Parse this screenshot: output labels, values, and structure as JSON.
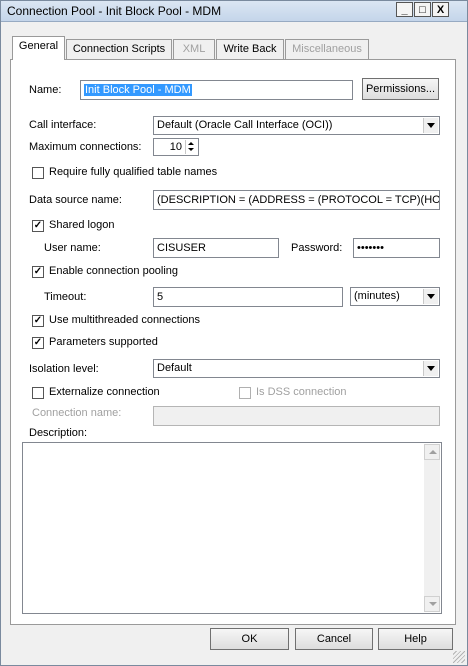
{
  "window": {
    "title": "Connection Pool - Init Block Pool - MDM",
    "minimize": "_",
    "maximize": "□",
    "close": "X"
  },
  "tabs": [
    {
      "label": "General",
      "active": true,
      "enabled": true
    },
    {
      "label": "Connection Scripts",
      "active": false,
      "enabled": true
    },
    {
      "label": "XML",
      "active": false,
      "enabled": false
    },
    {
      "label": "Write Back",
      "active": false,
      "enabled": true
    },
    {
      "label": "Miscellaneous",
      "active": false,
      "enabled": false
    }
  ],
  "general": {
    "name_label": "Name:",
    "name_value": "Init Block Pool - MDM",
    "permissions_button": "Permissions...",
    "call_interface_label": "Call interface:",
    "call_interface_value": "Default (Oracle Call Interface (OCI))",
    "max_connections_label": "Maximum connections:",
    "max_connections_value": "10",
    "require_qualified_label": "Require fully qualified table names",
    "require_qualified_checked": false,
    "data_source_label": "Data source name:",
    "data_source_value": "(DESCRIPTION = (ADDRESS = (PROTOCOL = TCP)(HO",
    "shared_logon_label": "Shared logon",
    "shared_logon_checked": true,
    "user_name_label": "User name:",
    "user_name_value": "CISUSER",
    "password_label": "Password:",
    "password_value": "•••••••",
    "enable_pooling_label": "Enable connection pooling",
    "enable_pooling_checked": true,
    "timeout_label": "Timeout:",
    "timeout_value": "5",
    "timeout_unit": "(minutes)",
    "multithreaded_label": "Use multithreaded connections",
    "multithreaded_checked": true,
    "parameters_label": "Parameters supported",
    "parameters_checked": true,
    "isolation_label": "Isolation level:",
    "isolation_value": "Default",
    "externalize_label": "Externalize connection",
    "externalize_checked": false,
    "dss_label": "Is DSS connection",
    "dss_checked": false,
    "connection_name_label": "Connection name:",
    "connection_name_value": "",
    "description_label": "Description:",
    "description_value": ""
  },
  "footer": {
    "ok": "OK",
    "cancel": "Cancel",
    "help": "Help"
  }
}
